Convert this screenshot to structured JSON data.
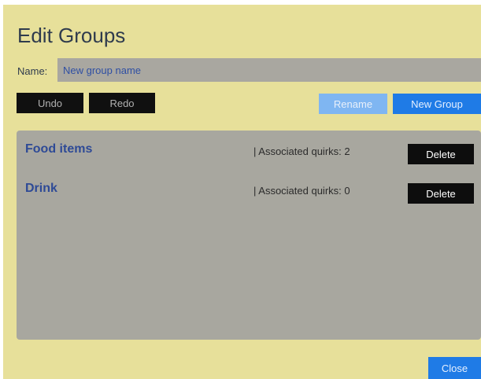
{
  "dialog": {
    "title": "Edit Groups",
    "name_label": "Name:",
    "name_placeholder": "New group name",
    "name_value": ""
  },
  "toolbar": {
    "undo_label": "Undo",
    "redo_label": "Redo",
    "rename_label": "Rename",
    "new_group_label": "New Group"
  },
  "groups": [
    {
      "name": "Food items",
      "quirks_text": "| Associated quirks: 2",
      "delete_label": "Delete"
    },
    {
      "name": "Drink",
      "quirks_text": "| Associated quirks: 0",
      "delete_label": "Delete"
    }
  ],
  "footer": {
    "close_label": "Close"
  },
  "colors": {
    "dialog_bg": "#e7e09a",
    "panel_bg": "#a8a79f",
    "primary": "#1f7be6",
    "primary_disabled": "#7fb6f2",
    "dark_button": "#101010",
    "group_name": "#2e4a96"
  }
}
